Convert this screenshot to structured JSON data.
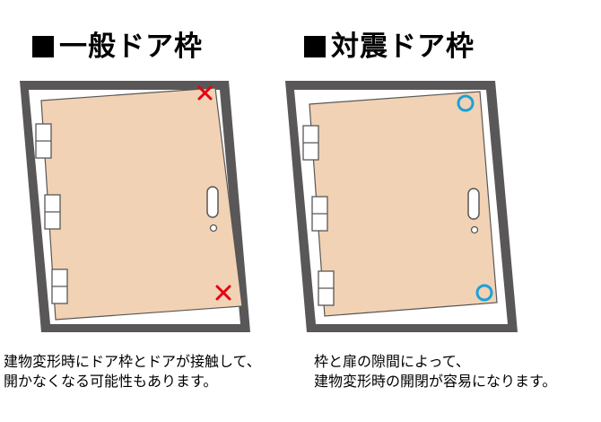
{
  "general": {
    "title": "一般ドア枠",
    "caption_line1": "建物変形時にドア枠とドアが接触して、",
    "caption_line2": "開かなくなる可能性もあります。"
  },
  "seismic": {
    "title": "対震ドア枠",
    "caption_line1": "枠と扉の隙間によって、",
    "caption_line2": "建物変形時の開閉が容易になります。"
  },
  "colors": {
    "frame": "#595757",
    "door": "#f2d2b4",
    "x_mark": "#e60012",
    "circle_mark": "#1ba1d8"
  }
}
